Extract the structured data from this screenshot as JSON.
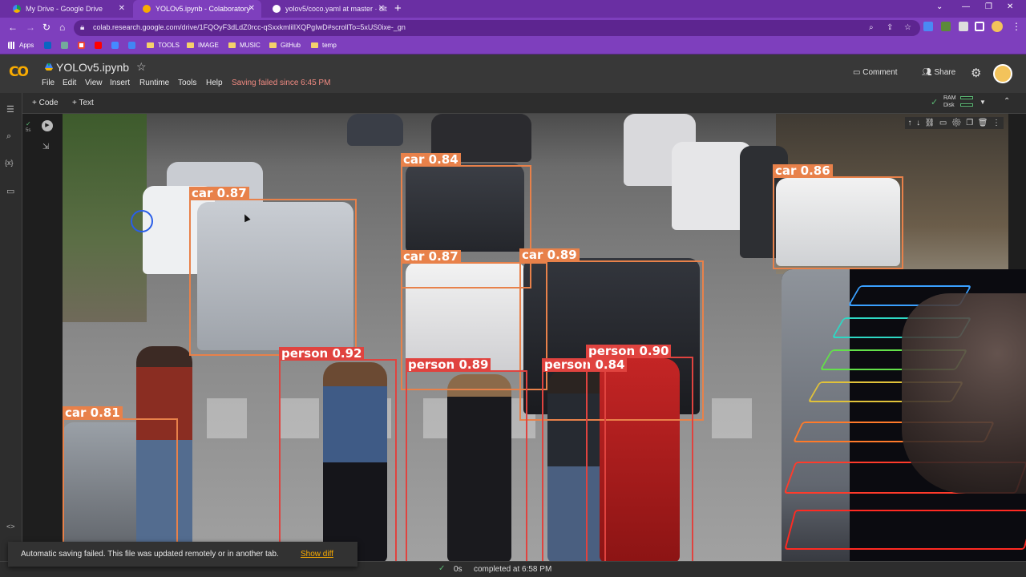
{
  "browser": {
    "tabs": [
      {
        "title": "My Drive - Google Drive",
        "icon": "google-drive-icon",
        "active": false
      },
      {
        "title": "YOLOv5.ipynb - Colaboratory",
        "icon": "colab-icon",
        "active": true
      },
      {
        "title": "yolov5/coco.yaml at master · ult",
        "icon": "github-icon",
        "active": false
      }
    ],
    "url": "colab.research.google.com/drive/1FQOyF3dLdZ0rcc-qSxxkmlilIXQPgIwD#scrollTo=5xUS0ixe-_gn",
    "bookmarks": [
      {
        "label": "Apps",
        "icon": "apps-grid-icon"
      },
      {
        "label": "",
        "icon": "linkedin-icon"
      },
      {
        "label": "",
        "icon": "chatgpt-icon"
      },
      {
        "label": "",
        "icon": "gmail-icon"
      },
      {
        "label": "",
        "icon": "youtube-icon"
      },
      {
        "label": "",
        "icon": "messenger-icon"
      },
      {
        "label": "",
        "icon": "translate-icon"
      },
      {
        "label": "TOOLS",
        "icon": "folder-icon"
      },
      {
        "label": "IMAGE",
        "icon": "folder-icon"
      },
      {
        "label": "MUSIC",
        "icon": "folder-icon"
      },
      {
        "label": "GitHub",
        "icon": "folder-icon"
      },
      {
        "label": "temp",
        "icon": "folder-icon"
      }
    ]
  },
  "colab": {
    "logo": "CO",
    "notebook_title": "YOLOv5.ipynb",
    "menu": [
      "File",
      "Edit",
      "View",
      "Insert",
      "Runtime",
      "Tools",
      "Help"
    ],
    "save_status": "Saving failed since 6:45 PM",
    "comment_label": "Comment",
    "share_label": "Share",
    "add_code_label": "+ Code",
    "add_text_label": "+ Text",
    "ram_label": "RAM",
    "disk_label": "Disk",
    "cell_index": "5s"
  },
  "detections": [
    {
      "label": "car 0.87",
      "class": "car"
    },
    {
      "label": "car 0.84",
      "class": "car"
    },
    {
      "label": "car 0.86",
      "class": "car"
    },
    {
      "label": "car 0.87",
      "class": "car"
    },
    {
      "label": "car 0.89",
      "class": "car"
    },
    {
      "label": "car 0.81",
      "class": "car"
    },
    {
      "label": "person 0.92",
      "class": "person"
    },
    {
      "label": "person 0.89",
      "class": "person"
    },
    {
      "label": "person 0.84",
      "class": "person"
    },
    {
      "label": "person 0.90",
      "class": "person"
    }
  ],
  "colors": {
    "car_box": "#e8814a",
    "person_box": "#e0433f",
    "browser_purple": "#7e3fbd",
    "colab_orange": "#f9ab00"
  },
  "status": {
    "elapsed": "0s",
    "completed": "completed at 6:58 PM"
  },
  "toast": {
    "message": "Automatic saving failed. This file was updated remotely or in another tab.",
    "action": "Show diff"
  }
}
